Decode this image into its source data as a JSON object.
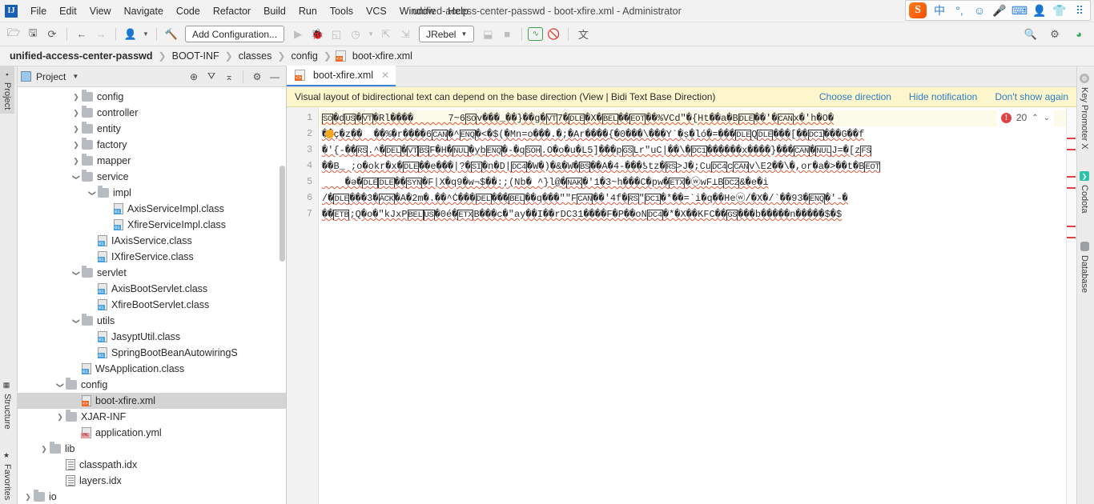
{
  "window": {
    "title": "unified-access-center-passwd - boot-xfire.xml - Administrator",
    "logo": "IJ"
  },
  "menu": {
    "items": [
      {
        "label": "File"
      },
      {
        "label": "Edit"
      },
      {
        "label": "View"
      },
      {
        "label": "Navigate"
      },
      {
        "label": "Code"
      },
      {
        "label": "Refactor"
      },
      {
        "label": "Build"
      },
      {
        "label": "Run"
      },
      {
        "label": "Tools"
      },
      {
        "label": "VCS"
      },
      {
        "label": "Window"
      },
      {
        "label": "Help"
      }
    ]
  },
  "tray": {
    "items": [
      {
        "name": "sogou-logo",
        "glyph": "S"
      },
      {
        "name": "ime-chinese",
        "glyph": "中"
      },
      {
        "name": "ime-punctuation",
        "glyph": "°,"
      },
      {
        "name": "ime-emoji",
        "glyph": "☺"
      },
      {
        "name": "ime-voice",
        "glyph": "🎤"
      },
      {
        "name": "ime-keyboard",
        "glyph": "⌨"
      },
      {
        "name": "ime-user",
        "glyph": "👤"
      },
      {
        "name": "ime-skin",
        "glyph": "👕"
      },
      {
        "name": "ime-toolbox",
        "glyph": "⠿"
      }
    ]
  },
  "toolbar": {
    "open_label": "Open",
    "save_label": "Save All",
    "sync_label": "Synchronize",
    "back_label": "Back",
    "forward_label": "Forward",
    "profile_label": "Profiles",
    "build_label": "Build Project",
    "run_config": "Add Configuration...",
    "run_label": "Run",
    "debug_label": "Debug",
    "run_coverage_label": "Run with Coverage",
    "profiler_label": "Profiler",
    "attach_label": "Attach",
    "update_label": "Update Application",
    "jrebel_label": "JRebel",
    "rerun_label": "Rerun",
    "stop_label": "Stop",
    "monitor_label": "JRebel Monitor",
    "disable_label": "Disable",
    "translate_label": "Translate",
    "search_label": "Search Everywhere",
    "settings_label": "Settings",
    "ide_label": "IDE Features"
  },
  "breadcrumb": {
    "items": [
      {
        "label": "unified-access-center-passwd",
        "bold": true,
        "icon": null
      },
      {
        "label": "BOOT-INF",
        "bold": false,
        "icon": null
      },
      {
        "label": "classes",
        "bold": false,
        "icon": null
      },
      {
        "label": "config",
        "bold": false,
        "icon": null
      },
      {
        "label": "boot-xfire.xml",
        "bold": false,
        "icon": "xml-icon"
      }
    ],
    "separator": "❯"
  },
  "left_strip": {
    "project": "Project",
    "structure": "Structure",
    "favorites": "Favorites"
  },
  "right_strip": {
    "key_promoter": "Key Promoter X",
    "codota": "Codota",
    "database": "Database"
  },
  "project_panel": {
    "title": "Project",
    "tools": {
      "locate": "Select Opened File",
      "expand": "Expand All",
      "collapse": "Collapse All",
      "settings": "Settings",
      "hide": "Hide"
    },
    "tree": [
      {
        "label": "config",
        "type": "folder",
        "indent": 4,
        "arrow": "collapsed"
      },
      {
        "label": "controller",
        "type": "folder",
        "indent": 4,
        "arrow": "collapsed"
      },
      {
        "label": "entity",
        "type": "folder",
        "indent": 4,
        "arrow": "collapsed"
      },
      {
        "label": "factory",
        "type": "folder",
        "indent": 4,
        "arrow": "collapsed"
      },
      {
        "label": "mapper",
        "type": "folder",
        "indent": 4,
        "arrow": "collapsed"
      },
      {
        "label": "service",
        "type": "folder",
        "indent": 4,
        "arrow": "expanded"
      },
      {
        "label": "impl",
        "type": "folder",
        "indent": 5,
        "arrow": "expanded"
      },
      {
        "label": "AxisServiceImpl.class",
        "type": "class",
        "indent": 6,
        "arrow": "none"
      },
      {
        "label": "XfireServiceImpl.class",
        "type": "class",
        "indent": 6,
        "arrow": "none"
      },
      {
        "label": "IAxisService.class",
        "type": "class",
        "indent": 5,
        "arrow": "none"
      },
      {
        "label": "IXfireService.class",
        "type": "class",
        "indent": 5,
        "arrow": "none"
      },
      {
        "label": "servlet",
        "type": "folder",
        "indent": 4,
        "arrow": "expanded"
      },
      {
        "label": "AxisBootServlet.class",
        "type": "class",
        "indent": 5,
        "arrow": "none"
      },
      {
        "label": "XfireBootServlet.class",
        "type": "class",
        "indent": 5,
        "arrow": "none"
      },
      {
        "label": "utils",
        "type": "folder",
        "indent": 4,
        "arrow": "expanded"
      },
      {
        "label": "JasyptUtil.class",
        "type": "class",
        "indent": 5,
        "arrow": "none"
      },
      {
        "label": "SpringBootBeanAutowiringS",
        "type": "class",
        "indent": 5,
        "arrow": "none"
      },
      {
        "label": "WsApplication.class",
        "type": "class",
        "indent": 4,
        "arrow": "none"
      },
      {
        "label": "config",
        "type": "folder",
        "indent": 3,
        "arrow": "expanded"
      },
      {
        "label": "boot-xfire.xml",
        "type": "xml",
        "indent": 4,
        "arrow": "none",
        "selected": true
      },
      {
        "label": "XJAR-INF",
        "type": "folder",
        "indent": 3,
        "arrow": "collapsed"
      },
      {
        "label": "application.yml",
        "type": "yml",
        "indent": 4,
        "arrow": "none"
      },
      {
        "label": "lib",
        "type": "folder",
        "indent": 2,
        "arrow": "collapsed"
      },
      {
        "label": "classpath.idx",
        "type": "idx",
        "indent": 3,
        "arrow": "none"
      },
      {
        "label": "layers.idx",
        "type": "idx",
        "indent": 3,
        "arrow": "none"
      },
      {
        "label": "io",
        "type": "folder",
        "indent": 1,
        "arrow": "collapsed"
      }
    ]
  },
  "editor": {
    "tab": {
      "label": "boot-xfire.xml",
      "close": "✕",
      "icon": "xml-icon"
    },
    "notification": {
      "message": "Visual layout of bidirectional text can depend on the base direction (View | Bidi Text Base Direction)",
      "actions": [
        {
          "label": "Choose direction"
        },
        {
          "label": "Hide notification"
        },
        {
          "label": "Don't show again"
        }
      ]
    },
    "inspection_widget": {
      "count": "20",
      "icon": "error-icon",
      "up": "︿",
      "down": "﹀"
    },
    "line_numbers": [
      "1",
      "2",
      "3",
      "4",
      "5",
      "6",
      "7"
    ],
    "lines": [
      "SO�dUS�VT�Rl����      7~6SOv���_��}��g�VT7�DLE�X�BEL��EOT��%VCd\"�{Ht��a�BDLE��'�CANx�'h�O�",
      "��ç�z��  ��%�r����6CAN�^ENQ�<�$(�Mn=o���.�;�Ar����{�0���\\���Y`�ș�ló�=���DLEQDLE���[��DC1���G��f",
      "�'{-��RS.^�DEL�VTBSF�H�NUL�ybENQ�-�qSOH.O�o�u�L5]���pGSLr\"uC|��\\�DC1������x����}���CAN�NULJ=�[zFS",
      "��B_ ;o�okr�x�DLE��e���|?�SI�n�D|DC4�W�)�&�W�BS��A�4-���ƾtz�RS>J�;CuDC4cCANv\\E2��\\�,or�a�>��t�BEOT",
      "    �ə�DLEDLE��SYN�F|X�q9�w¬$��:;(Nb� ^}l@�NAK�'1�3~h���C�pw�ETX�ⓦwF⊥BDC2&�e�i",
      "/�DLE���3�ACK�A�2m�.��^Ċ���DEL���BEL��q���\"\"FCAN��'4f�RS\"DC1�*��=`i�q��Heⓦ/�X�/`��93�ENQ�'-�",
      "��ETB;Q�o�\"kJxPBELUS�0é�ETXB���c�\"ay��I��rDC31����F�P��oNDC4�*�X��KFC��GS���b�����n�����$�$"
    ]
  },
  "colors": {
    "accent": "#3a82dc",
    "notification_bg": "#fdf6cd",
    "link": "#2b7ec1",
    "error": "#e04343",
    "selection": "#d4d4d4",
    "squiggle": "#e05a3f"
  }
}
